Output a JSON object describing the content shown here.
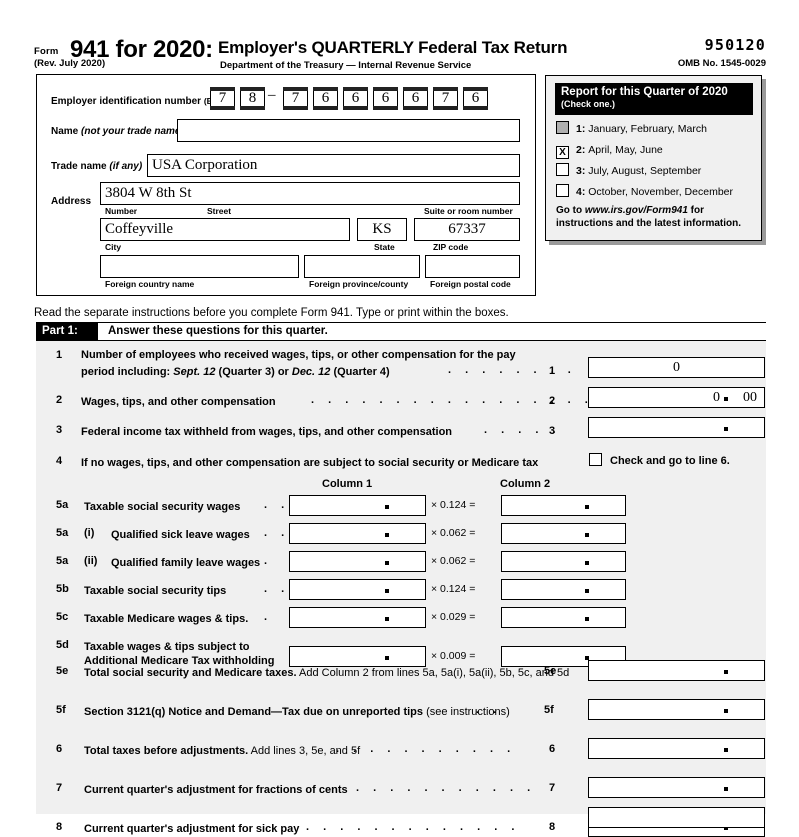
{
  "header": {
    "form_label": "Form",
    "form_number": "941 for 2020:",
    "rev": "(Rev. July 2020)",
    "title": "Employer's QUARTERLY Federal Tax Return",
    "department": "Department of the Treasury — Internal Revenue Service",
    "form_code": "950120",
    "omb": "OMB No. 1545-0029"
  },
  "employer": {
    "ein_label": "Employer identification number",
    "ein_paren": "(EIN)",
    "ein_digits": [
      "7",
      "8",
      "7",
      "6",
      "6",
      "6",
      "6",
      "7",
      "6"
    ],
    "ein_dash": "–",
    "name_label": "Name",
    "name_hint": "(not your trade name)",
    "name_value": "",
    "trade_label": "Trade name",
    "trade_hint": "(if any)",
    "trade_value": "USA Corporation",
    "address_label": "Address",
    "address_value": "3804 W 8th St",
    "sub_number": "Number",
    "sub_street": "Street",
    "sub_suite": "Suite or room number",
    "city_value": "Coffeyville",
    "sub_city": "City",
    "state_value": "KS",
    "sub_state": "State",
    "zip_value": "67337",
    "sub_zip": "ZIP code",
    "foreign_country_value": "",
    "sub_foreign_country": "Foreign country name",
    "foreign_province_value": "",
    "sub_foreign_province": "Foreign province/county",
    "foreign_postal_value": "",
    "sub_foreign_postal": "Foreign postal code"
  },
  "quarter": {
    "title": "Report for this Quarter of 2020",
    "subtitle": "(Check one.)",
    "options": [
      {
        "num": "1:",
        "months": "January, February, March",
        "mark": "",
        "state": "hover"
      },
      {
        "num": "2:",
        "months": "April, May, June",
        "mark": "X",
        "state": "checked"
      },
      {
        "num": "3:",
        "months": "July, August, September",
        "mark": "",
        "state": "empty"
      },
      {
        "num": "4:",
        "months": "October, November, December",
        "mark": "",
        "state": "empty"
      }
    ],
    "goto_pre": "Go to ",
    "goto_url": "www.irs.gov/Form941",
    "goto_post": " for instructions and the latest information."
  },
  "read_instruction": "Read the separate instructions before you complete Form 941. Type or print within the boxes.",
  "part1": {
    "tag": "Part 1:",
    "heading": "Answer these questions for this quarter.",
    "column1_header": "Column 1",
    "column2_header": "Column 2",
    "line4_checkbox_label": "Check and go to line 6.",
    "lines": [
      {
        "num": "1",
        "text_line1": "Number of employees who received wages, tips, or other compensation for the pay",
        "text_line2_a": "period  including: ",
        "text_line2_b": "Sept. 12",
        "text_line2_c": " (Quarter 3) or ",
        "text_line2_d": "Dec. 12",
        "text_line2_e": " (Quarter 4)",
        "right_label": "1",
        "value": "0",
        "cents": ""
      },
      {
        "num": "2",
        "text": "Wages, tips, and other compensation",
        "right_label": "2",
        "value": "0",
        "cents": "00"
      },
      {
        "num": "3",
        "text": "Federal income tax withheld from wages, tips, and other compensation",
        "right_label": "3",
        "value": "",
        "cents": ""
      },
      {
        "num": "4",
        "text": "If no wages, tips, and other compensation are subject to social security or Medicare tax"
      }
    ],
    "col_rows": [
      {
        "num": "5a",
        "sub": "",
        "label": "Taxable social security wages",
        "dots": ".  .",
        "mult": "× 0.124 =",
        "col1": "",
        "col2": ""
      },
      {
        "num": "5a",
        "sub": "(i)",
        "label": "Qualified sick leave wages",
        "dots": ".  .",
        "mult": "× 0.062 =",
        "col1": "",
        "col2": ""
      },
      {
        "num": "5a",
        "sub": "(ii)",
        "label": "Qualified family leave wages",
        "dots": ".",
        "mult": "× 0.062 =",
        "col1": "",
        "col2": ""
      },
      {
        "num": "5b",
        "sub": "",
        "label": "Taxable social security tips",
        "dots": ".   .   .",
        "mult": "× 0.124 =",
        "col1": "",
        "col2": ""
      },
      {
        "num": "5c",
        "sub": "",
        "label": "Taxable Medicare wages & tips.",
        "dots": ".",
        "mult": "× 0.029 =",
        "col1": "",
        "col2": ""
      },
      {
        "num": "5d",
        "sub": "",
        "label": "Taxable wages & tips subject to",
        "label2": "Additional Medicare Tax withholding",
        "dots": "",
        "mult": "× 0.009 =",
        "col1": "",
        "col2": ""
      }
    ],
    "total_rows": [
      {
        "num": "5e",
        "bold": "Total social security and Medicare taxes.",
        "reg": " Add Column 2 from lines 5a, 5a(i), 5a(ii), 5b, 5c, and 5d",
        "dots": "",
        "right_label": "5e",
        "value": ""
      },
      {
        "num": "5f",
        "bold": "Section 3121(q) Notice and Demand—Tax due on unreported tips",
        "reg": " (see instructions)",
        "dots": ".   .",
        "right_label": "5f",
        "value": ""
      },
      {
        "num": "6",
        "bold": "Total taxes before adjustments.",
        "reg": " Add lines 3, 5e, and 5f",
        "dots": ".  .  .  .  .  .  .  .  .  .  .",
        "right_label": "6",
        "value": ""
      },
      {
        "num": "7",
        "bold": "Current quarter's adjustment for fractions of cents",
        "reg": "",
        "dots": ".  .  .  .  .  .  .  .  .  .  .",
        "right_label": "7",
        "value": ""
      },
      {
        "num": "8",
        "bold": "Current quarter's adjustment for sick pay",
        "reg": "",
        "dots": ".  .  .  .  .  .  .  .  .  .  .  .  .",
        "right_label": "8",
        "value": ""
      }
    ]
  }
}
